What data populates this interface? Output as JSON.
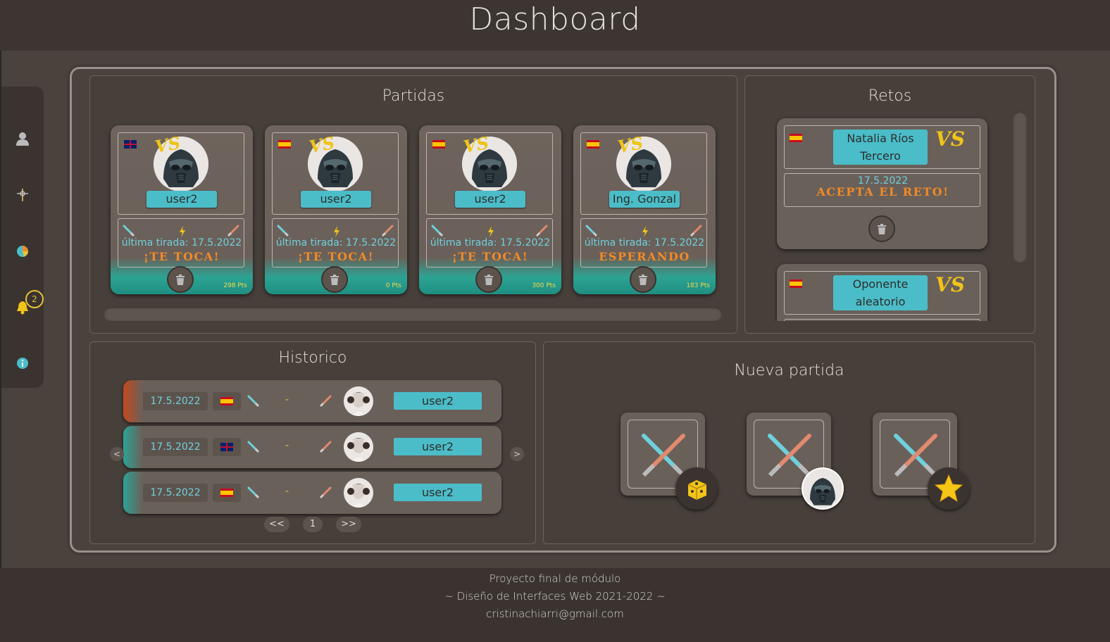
{
  "app": {
    "title": "Dashboard"
  },
  "sidebar": {
    "items": [
      {
        "icon": "user-icon"
      },
      {
        "icon": "game-icon"
      },
      {
        "icon": "stats-icon"
      },
      {
        "icon": "bell-icon",
        "badge": "2"
      },
      {
        "icon": "info-icon"
      }
    ]
  },
  "partidas": {
    "title": "Partidas",
    "cards": [
      {
        "flag": "uk",
        "vs": "VS",
        "user": "user2",
        "tirada": "última tirada: 17.5.2022",
        "status": "¡TE TOCA!",
        "pts": "298 Pts"
      },
      {
        "flag": "es",
        "vs": "VS",
        "user": "user2",
        "tirada": "última tirada: 17.5.2022",
        "status": "¡TE TOCA!",
        "pts": "0 Pts"
      },
      {
        "flag": "es",
        "vs": "VS",
        "user": "user2",
        "tirada": "última tirada: 17.5.2022",
        "status": "¡TE TOCA!",
        "pts": "300 Pts"
      },
      {
        "flag": "es",
        "vs": "VS",
        "user": "Ing. Gonzal",
        "tirada": "última tirada: 17.5.2022",
        "status": "ESPERANDO",
        "pts": "183 Pts"
      }
    ]
  },
  "retos": {
    "title": "Retos",
    "items": [
      {
        "flag": "es",
        "name_line1": "Natalia Ríos",
        "name_line2": "Tercero",
        "vs": "VS",
        "date": "17.5.2022",
        "action": "ACEPTA EL RETO!"
      },
      {
        "flag": "es",
        "name_line1": "Oponente",
        "name_line2": "aleatorio",
        "vs": "VS"
      }
    ]
  },
  "historico": {
    "title": "Historico",
    "rows": [
      {
        "date": "17.5.2022",
        "flag": "es",
        "result": "-",
        "user": "user2",
        "status_color": "#c24a1f"
      },
      {
        "date": "17.5.2022",
        "flag": "uk",
        "result": "-",
        "user": "user2",
        "status_color": "#2ca393"
      },
      {
        "date": "17.5.2022",
        "flag": "es",
        "result": "-",
        "user": "user2",
        "status_color": "#2ca393"
      }
    ],
    "prev": "<",
    "next": ">",
    "pagination": {
      "first": "<<",
      "page": "1",
      "last": ">>"
    }
  },
  "nueva": {
    "title": "Nueva partida",
    "modes": [
      {
        "icon": "dice-icon"
      },
      {
        "icon": "vader-icon"
      },
      {
        "icon": "star-icon"
      }
    ]
  },
  "footer": {
    "line1": "Proyecto final de módulo",
    "line2": "~ Diseño de Interfaces Web 2021-2022 ~",
    "line3": "cristinachiarri@gmail.com"
  },
  "colors": {
    "accent": "#4bbdc8",
    "turn": "#f28b26",
    "vs": "#f0c419",
    "teal": "#2ca393"
  }
}
